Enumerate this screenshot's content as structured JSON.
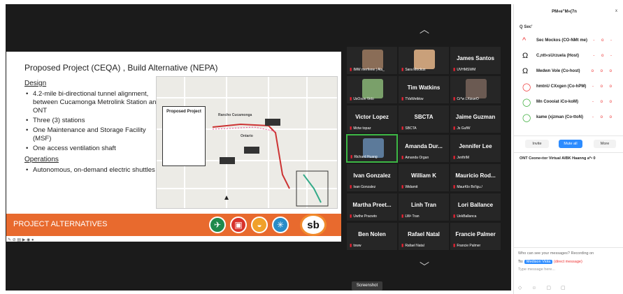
{
  "slide": {
    "title": "Proposed Project (CEQA) , Build Alternative (NEPA)",
    "design_heading": "Design",
    "design_bullets": [
      "4.2-mile bi-directional tunnel alignment, between Cucamonga Metrolink Station and ONT",
      "Three (3) stations",
      "One Maintenance and Storage Facility (MSF)",
      "One access ventilation shaft"
    ],
    "operations_heading": "Operations",
    "operations_bullets": [
      "Autonomous, on-demand electric shuttles"
    ],
    "map": {
      "legend_title": "Proposed Project",
      "label_rancho": "Rancho Cucamonga",
      "label_ontario": "Ontario"
    },
    "footer": "PROJECT ALTERNATIVES",
    "logo_text": "sb"
  },
  "gallery": {
    "tiles": [
      {
        "big": "",
        "label": "IMW  merfeew | Ala_",
        "avatar_color": "#8a6d57"
      },
      {
        "big": "",
        "label": "Sara Mockus",
        "avatar_color": "#c9a07a"
      },
      {
        "big": "James Santos",
        "label": "UVHMSWM",
        "avatar_color": ""
      },
      {
        "big": "",
        "label": "UsOxon Veto",
        "avatar_color": "#7aa06a"
      },
      {
        "big": "Tim Watkins",
        "label": "TVaWetkkw",
        "avatar_color": ""
      },
      {
        "big": "",
        "label": "Cr*w  LXizueO",
        "avatar_color": "#6b5a52"
      },
      {
        "big": "Victor Lopez",
        "label": "Mctw topaz",
        "avatar_color": ""
      },
      {
        "big": "SBCTA",
        "label": "SBCTA",
        "avatar_color": ""
      },
      {
        "big": "Jaime Guzman",
        "label": "Js   GufW",
        "avatar_color": ""
      },
      {
        "big": "",
        "label": "Richard Huang",
        "avatar_color": "#5c7a9a"
      },
      {
        "big": "Amanda Dur...",
        "label": "Amanda Organ",
        "avatar_color": ""
      },
      {
        "big": "Jennifer Lee",
        "label": "JvnftrIM",
        "avatar_color": ""
      },
      {
        "big": "Ivan Gonzalez",
        "label": "Ivan Gonzalez",
        "avatar_color": ""
      },
      {
        "big": "William K",
        "label": "Widamit",
        "avatar_color": ""
      },
      {
        "big": "Mauricio Rod...",
        "label": "MaurKlo Bo'lgu./",
        "avatar_color": ""
      },
      {
        "big": "Martha Preet...",
        "label": "Uwthe Pracwto",
        "avatar_color": ""
      },
      {
        "big": "Linh Tran",
        "label": "LW• Tran",
        "avatar_color": ""
      },
      {
        "big": "Lori Ballance",
        "label": "UekBallanca",
        "avatar_color": ""
      },
      {
        "big": "Ben Nolen",
        "label": "txww",
        "avatar_color": ""
      },
      {
        "big": "Rafael Natal",
        "label": "Rafael Natal",
        "avatar_color": ""
      },
      {
        "big": "Francie Palmer",
        "label": "Francie Palmer",
        "avatar_color": ""
      }
    ],
    "screenshot_tip": "Screenshot"
  },
  "panel": {
    "title": "PM«e\"M«(7n",
    "close": "x",
    "search": "Q  Sec'",
    "participants": [
      {
        "icon": "^",
        "icon_color": "#e33",
        "name": "Sec Mockos (CO-NMt me)",
        "stat": "- o -"
      },
      {
        "icon": "Ω",
        "icon_color": "#111",
        "name": "C,ntt«sUrzuela (Host)",
        "stat": "- o -"
      },
      {
        "icon": "Ω",
        "icon_color": "#111",
        "name": "Medwn Vole  (Co-host)",
        "stat": "o o o"
      },
      {
        "icon": "◯",
        "icon_color": "#e33",
        "name": "hmtnU  CXxgen (Co-hPM)",
        "stat": "- o o"
      },
      {
        "icon": "◯",
        "icon_color": "#3a3",
        "name": "Mn  Coooiat iCo-koM)",
        "stat": "- o o"
      },
      {
        "icon": "◯",
        "icon_color": "#3a3",
        "name": "kame (xjzman (Co-ttoN)",
        "stat": "- o o"
      }
    ],
    "invite": "Invite",
    "mute_all": "Mute all",
    "more": "More",
    "info": "ONT Ceone«tor Virtual AlBK Haanng   a*• 0",
    "chat_who": "Who can see your messages? Recording on",
    "chat_to_label": "To:",
    "chat_recipient": "Medison Viola",
    "chat_dm": "(direct message)",
    "chat_placeholder": "Type message here...",
    "chat_tools": "◇ ☺ ▢ ▢"
  }
}
